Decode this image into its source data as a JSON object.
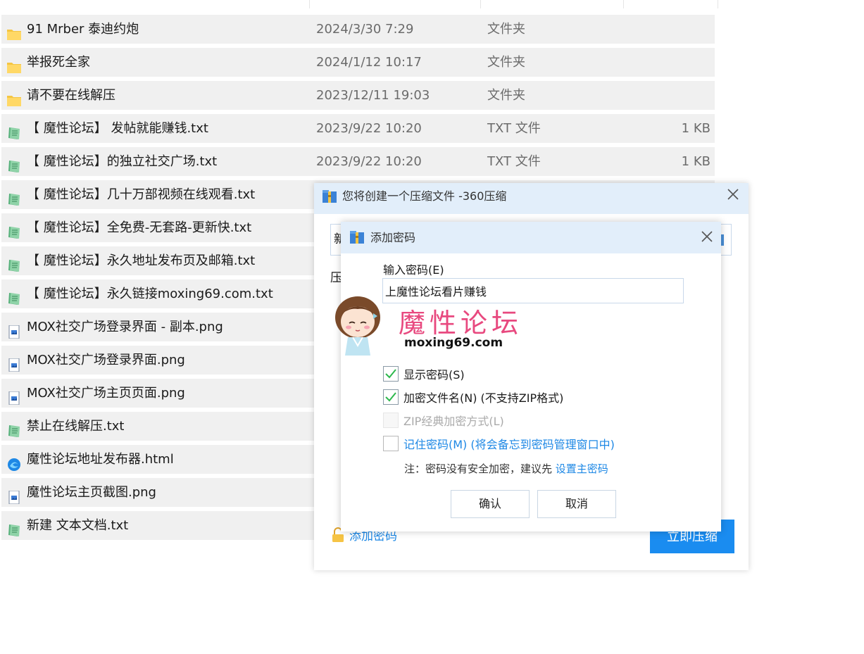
{
  "files": [
    {
      "icon": "folder",
      "name": "91 Mrber 泰迪约炮",
      "date": "2024/3/30 7:29",
      "type": "文件夹",
      "size": ""
    },
    {
      "icon": "folder",
      "name": "举报死全家",
      "date": "2024/1/12 10:17",
      "type": "文件夹",
      "size": ""
    },
    {
      "icon": "folder",
      "name": "请不要在线解压",
      "date": "2023/12/11 19:03",
      "type": "文件夹",
      "size": ""
    },
    {
      "icon": "txt",
      "name": "【 魔性论坛】 发帖就能赚钱.txt",
      "date": "2023/9/22 10:20",
      "type": "TXT 文件",
      "size": "1 KB"
    },
    {
      "icon": "txt",
      "name": "【 魔性论坛】的独立社交广场.txt",
      "date": "2023/9/22 10:20",
      "type": "TXT 文件",
      "size": "1 KB"
    },
    {
      "icon": "txt",
      "name": "【 魔性论坛】几十万部视频在线观看.txt",
      "date": "",
      "type": "",
      "size": ""
    },
    {
      "icon": "txt",
      "name": "【 魔性论坛】全免费-无套路-更新快.txt",
      "date": "",
      "type": "",
      "size": ""
    },
    {
      "icon": "txt",
      "name": "【 魔性论坛】永久地址发布页及邮箱.txt",
      "date": "",
      "type": "",
      "size": ""
    },
    {
      "icon": "txt",
      "name": "【 魔性论坛】永久链接moxing69.com.txt",
      "date": "",
      "type": "",
      "size": ""
    },
    {
      "icon": "png",
      "name": "MOX社交广场登录界面 - 副本.png",
      "date": "",
      "type": "",
      "size": ""
    },
    {
      "icon": "png",
      "name": "MOX社交广场登录界面.png",
      "date": "",
      "type": "",
      "size": ""
    },
    {
      "icon": "png",
      "name": "MOX社交广场主页页面.png",
      "date": "",
      "type": "",
      "size": ""
    },
    {
      "icon": "txt",
      "name": "禁止在线解压.txt",
      "date": "",
      "type": "",
      "size": ""
    },
    {
      "icon": "html",
      "name": "魔性论坛地址发布器.html",
      "date": "",
      "type": "",
      "size": ""
    },
    {
      "icon": "png",
      "name": "魔性论坛主页截图.png",
      "date": "",
      "type": "",
      "size": ""
    },
    {
      "icon": "txt",
      "name": "新建 文本文档.txt",
      "date": "",
      "type": "",
      "size": ""
    }
  ],
  "compress_dialog": {
    "title": "您将创建一个压缩文件 -360压缩",
    "path_value": "新",
    "format_label": "压",
    "add_password_link": "添加密码",
    "compress_button": "立即压缩"
  },
  "password_dialog": {
    "title": "添加密码",
    "password_label": "输入密码(E)",
    "password_value": "上魔性论坛看片赚钱",
    "brand_title": "魔性论坛",
    "brand_url": "moxing69.com",
    "options": [
      {
        "label": "显示密码(S)",
        "checked": true,
        "disabled": false,
        "link": false
      },
      {
        "label": "加密文件名(N) (不支持ZIP格式)",
        "checked": true,
        "disabled": false,
        "link": false
      },
      {
        "label": "ZIP经典加密方式(L)",
        "checked": false,
        "disabled": true,
        "link": false
      },
      {
        "label": "记住密码(M) (将会备忘到密码管理窗口中)",
        "checked": false,
        "disabled": false,
        "link": true
      }
    ],
    "note_prefix": "注：密码没有安全加密，建议先",
    "note_link": "设置主密码",
    "ok_button": "确认",
    "cancel_button": "取消"
  },
  "colors": {
    "accent": "#1a8cf0",
    "link": "#1e88e5",
    "titlebar": "#e2eefa",
    "brand_pink": "#e8497f",
    "row_bg": "#f0f0f0"
  }
}
